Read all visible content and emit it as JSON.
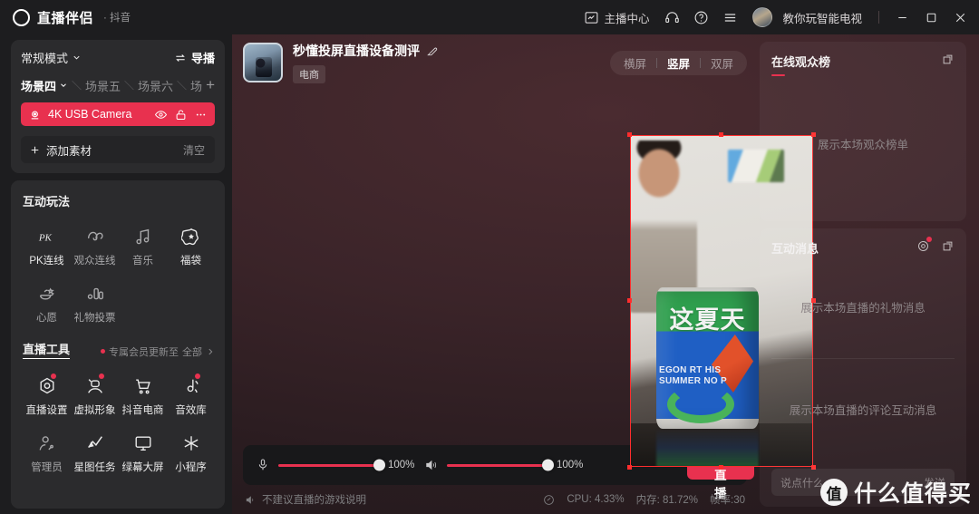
{
  "titlebar": {
    "brand": "直播伴侣",
    "brand_sub": "· 抖音",
    "anchor_center": "主播中心",
    "username": "教你玩智能电视",
    "icons": {
      "logo": "capsule-logo-icon",
      "anchor_center": "monitor-chart-icon",
      "support": "headset-icon",
      "help": "question-circle-icon",
      "menu": "hamburger-menu-icon",
      "minimize": "minimize-icon",
      "maximize": "maximize-icon",
      "close": "close-icon"
    }
  },
  "scene_panel": {
    "mode_label": "常规模式",
    "director_label": "导播",
    "tabs": [
      {
        "label": "场景四",
        "active": true
      },
      {
        "label": "场景五",
        "active": false
      },
      {
        "label": "场景六",
        "active": false
      },
      {
        "label": "场",
        "active": false
      }
    ],
    "add_scene": "+",
    "source": {
      "name": "4K USB Camera",
      "icons": [
        "camera-source-icon",
        "eye-icon",
        "unlock-icon",
        "more-dots-icon"
      ]
    },
    "add_material": "添加素材",
    "clear": "清空"
  },
  "interactive": {
    "section_title": "互动玩法",
    "items": [
      {
        "label": "PK连线",
        "icon": "pk-icon",
        "bright": false,
        "badge": false
      },
      {
        "label": "观众连线",
        "icon": "audience-link-icon",
        "bright": false,
        "badge": false
      },
      {
        "label": "音乐",
        "icon": "music-note-icon",
        "bright": false,
        "badge": false
      },
      {
        "label": "福袋",
        "icon": "lucky-bag-icon",
        "bright": true,
        "badge": false
      },
      {
        "label": "心愿",
        "icon": "wish-lamp-icon",
        "bright": false,
        "badge": false
      },
      {
        "label": "礼物投票",
        "icon": "gift-vote-icon",
        "bright": false,
        "badge": false
      }
    ]
  },
  "live_tools": {
    "section_title": "直播工具",
    "note": "专属会员更新至",
    "note_link": "全部",
    "items": [
      {
        "label": "直播设置",
        "icon": "live-settings-icon",
        "bright": true,
        "badge": true
      },
      {
        "label": "虚拟形象",
        "icon": "avatar-person-icon",
        "bright": true,
        "badge": true
      },
      {
        "label": "抖音电商",
        "icon": "shopping-cart-icon",
        "bright": true,
        "badge": false
      },
      {
        "label": "音效库",
        "icon": "sound-effect-icon",
        "bright": true,
        "badge": true
      },
      {
        "label": "管理员",
        "icon": "admin-user-icon",
        "bright": false,
        "badge": false
      },
      {
        "label": "星图任务",
        "icon": "star-task-icon",
        "bright": true,
        "badge": false
      },
      {
        "label": "绿幕大屏",
        "icon": "green-screen-monitor-icon",
        "bright": true,
        "badge": false
      },
      {
        "label": "小程序",
        "icon": "mini-program-icon",
        "bright": true,
        "badge": false
      }
    ]
  },
  "stream_header": {
    "title": "秒懂投屏直播设备测评",
    "edit_icon": "edit-pencil-icon",
    "tag": "电商",
    "orientation": [
      {
        "label": "横屏",
        "selected": false
      },
      {
        "label": "竖屏",
        "selected": true
      },
      {
        "label": "双屏",
        "selected": false
      }
    ]
  },
  "preview": {
    "can_text_cn": "这夏天",
    "can_text_en": "EGON RT HIS SUMMER NO P",
    "selection_color": "#ff2d2d"
  },
  "watermark": {
    "badge": "值",
    "text": "什么值得买"
  },
  "control_bar": {
    "mic_icon": "microphone-icon",
    "mic_value": "100%",
    "speaker_icon": "speaker-icon",
    "speaker_value": "100%",
    "icons": [
      {
        "name": "noise-reduction-icon"
      },
      {
        "name": "camera-beauty-icon"
      },
      {
        "name": "camera-switch-icon"
      },
      {
        "name": "settings-gear-icon"
      }
    ],
    "go_live": "开始直播",
    "accent": "#e8314f"
  },
  "status_bar": {
    "hint_icon": "speaker-warning-icon",
    "hint": "不建议直播的游戏说明",
    "search_icon": "search-circle-icon",
    "cpu": "CPU: 4.33%",
    "memory": "内存: 81.72%",
    "fps": "帧率:30"
  },
  "audience_panel": {
    "title": "在线观众榜",
    "popout_icon": "popout-window-icon",
    "empty": "展示本场观众榜单"
  },
  "message_panel": {
    "title": "互动消息",
    "gear_icon": "settings-gear-icon",
    "popout_icon": "popout-window-icon",
    "gift_empty": "展示本场直播的礼物消息",
    "comment_empty": "展示本场直播的评论互动消息",
    "input_placeholder": "说点什么...",
    "send_label": "发送"
  }
}
